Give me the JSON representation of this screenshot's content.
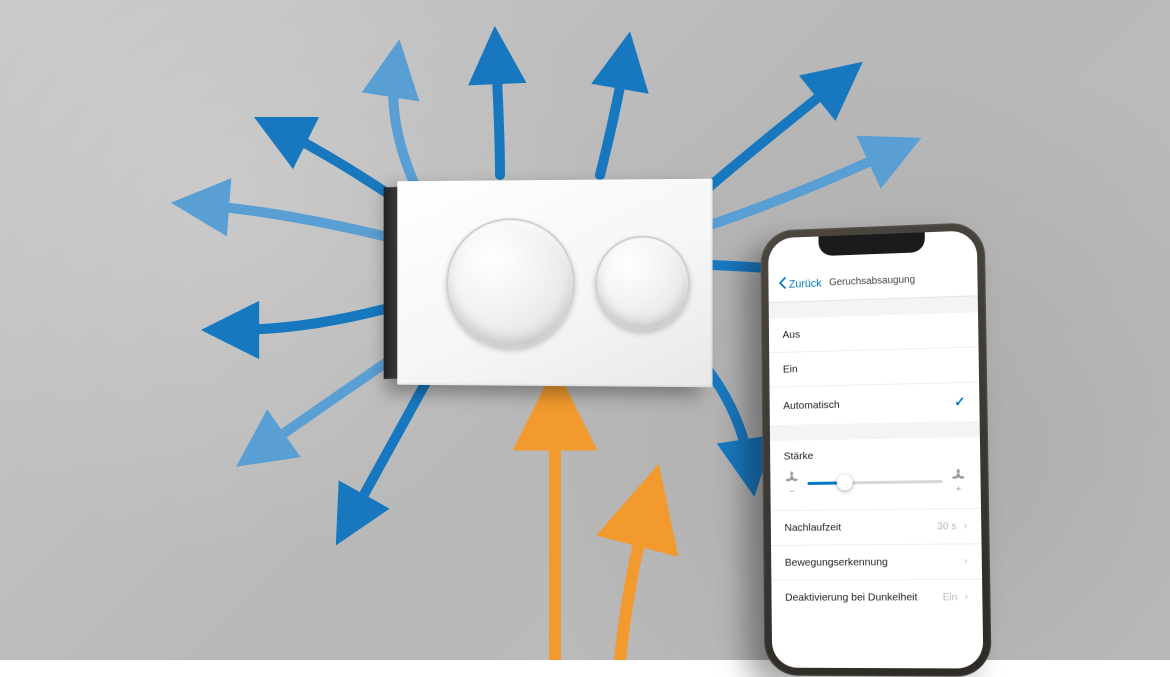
{
  "phone": {
    "back_label": "Zurück",
    "screen_title": "Geruchsabsaugung",
    "mode_options": {
      "off": "Aus",
      "on": "Ein",
      "auto": "Automatisch"
    },
    "selected_mode": "auto",
    "strength": {
      "label": "Stärke",
      "minus": "−",
      "plus": "+",
      "value_percent": 28
    },
    "rows": {
      "runout": {
        "label": "Nachlaufzeit",
        "value": "30 s"
      },
      "motion": {
        "label": "Bewegungserkennung",
        "value": ""
      },
      "darkness": {
        "label": "Deaktivierung bei Dunkelheit",
        "value": "Ein"
      }
    }
  },
  "colors": {
    "accent_blue": "#0079c1",
    "arrow_blue": "#1878bf",
    "arrow_orange": "#f29a2e"
  },
  "flush_plate": {
    "description": "Dual flush actuator plate",
    "large_button": "full-flush",
    "small_button": "half-flush"
  }
}
